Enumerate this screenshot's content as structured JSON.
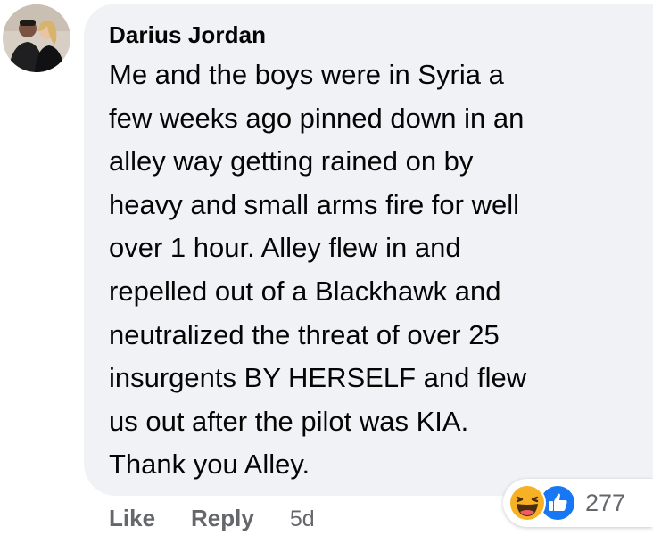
{
  "comment": {
    "author": "Darius Jordan",
    "text": "Me and the boys were in Syria a\nfew weeks ago pinned down in an\nalley way getting rained on by\nheavy and small arms fire for well\nover 1 hour. Alley flew in and\nrepelled out of a Blackhawk and\nneutralized the threat of over 25\ninsurgents BY HERSELF and flew\nus out after the pilot was KIA.\nThank you Alley."
  },
  "reactions": {
    "icons": [
      "haha-icon",
      "like-icon"
    ],
    "count": "277"
  },
  "actions": {
    "like_label": "Like",
    "reply_label": "Reply",
    "timestamp": "5d"
  },
  "colors": {
    "bubble": "#f0f2f5",
    "text": "#050505",
    "secondary_text": "#65676b",
    "like_blue": "#1877f2",
    "haha_yellow": "#f7b125"
  }
}
